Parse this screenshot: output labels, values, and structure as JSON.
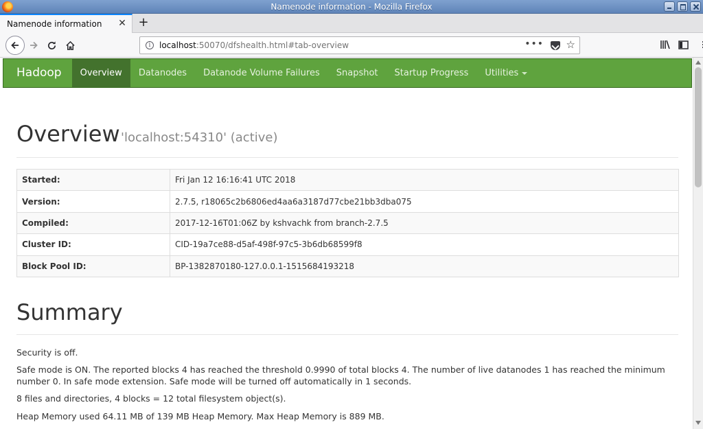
{
  "window": {
    "title": "Namenode information - Mozilla Firefox"
  },
  "tabs": [
    {
      "label": "Namenode information"
    }
  ],
  "urlbar": {
    "host": "localhost",
    "rest": ":50070/dfshealth.html#tab-overview"
  },
  "hadoop_nav": {
    "brand": "Hadoop",
    "items": [
      {
        "label": "Overview",
        "active": true
      },
      {
        "label": "Datanodes"
      },
      {
        "label": "Datanode Volume Failures"
      },
      {
        "label": "Snapshot"
      },
      {
        "label": "Startup Progress"
      },
      {
        "label": "Utilities"
      }
    ]
  },
  "overview": {
    "title": "Overview",
    "subtitle": "'localhost:54310' (active)",
    "rows": [
      {
        "key": "Started:",
        "value": "Fri Jan 12 16:16:41 UTC 2018"
      },
      {
        "key": "Version:",
        "value": "2.7.5, r18065c2b6806ed4aa6a3187d77cbe21bb3dba075"
      },
      {
        "key": "Compiled:",
        "value": "2017-12-16T01:06Z by kshvachk from branch-2.7.5"
      },
      {
        "key": "Cluster ID:",
        "value": "CID-19a7ce88-d5af-498f-97c5-3b6db68599f8"
      },
      {
        "key": "Block Pool ID:",
        "value": "BP-1382870180-127.0.0.1-1515684193218"
      }
    ]
  },
  "summary": {
    "title": "Summary",
    "security": "Security is off.",
    "safemode": "Safe mode is ON. The reported blocks 4 has reached the threshold 0.9990 of total blocks 4. The number of live datanodes 1 has reached the minimum number 0. In safe mode extension. Safe mode will be turned off automatically in 1 seconds.",
    "objects": "8 files and directories, 4 blocks = 12 total filesystem object(s).",
    "heap": "Heap Memory used 64.11 MB of 139 MB Heap Memory. Max Heap Memory is 889 MB."
  }
}
